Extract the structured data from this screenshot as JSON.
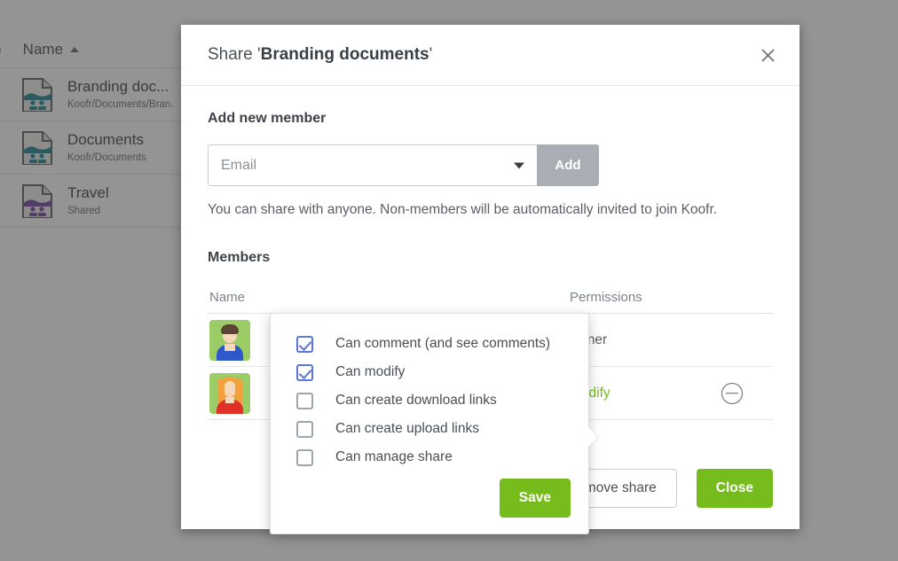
{
  "background": {
    "column_header": {
      "name_label": "Name",
      "sort_icon": "caret-up-icon",
      "left_paren": ")"
    },
    "rows": [
      {
        "title": "Branding doc...",
        "subtitle": "Koofr/Documents/Bran.",
        "icon": "shared-folder-icon",
        "accent": "#1a7f8e"
      },
      {
        "title": "Documents",
        "subtitle": "Koofr/Documents",
        "icon": "shared-folder-icon",
        "accent": "#1a7f8e"
      },
      {
        "title": "Travel",
        "subtitle": "Shared",
        "icon": "shared-folder-icon",
        "accent": "#6b3f9e"
      }
    ]
  },
  "dialog": {
    "title_prefix": "Share '",
    "title_bold": "Branding documents",
    "title_suffix": "'",
    "close_icon": "close-icon",
    "add_member": {
      "section_title": "Add new member",
      "email_placeholder": "Email",
      "email_value": "",
      "dropdown_icon": "chevron-down-icon",
      "add_label": "Add",
      "note": "You can share with anyone. Non-members will be automatically invited to join Koofr."
    },
    "members": {
      "section_title": "Members",
      "columns": {
        "name": "Name",
        "permissions": "Permissions",
        "actions": ""
      },
      "rows": [
        {
          "name": "",
          "permission": "owner",
          "permission_style": "plain",
          "avatar": "avatar-male-blue",
          "action_icon": ""
        },
        {
          "name": "",
          "permission": "modify",
          "permission_style": "green",
          "avatar": "avatar-female-red",
          "action_icon": "remove-member-icon"
        }
      ]
    },
    "footer": {
      "remove_share_label": "Remove share",
      "close_label": "Close"
    }
  },
  "permissions_popup": {
    "items": [
      {
        "label": "Can comment (and see comments)",
        "checked": true
      },
      {
        "label": "Can modify",
        "checked": true
      },
      {
        "label": "Can create download links",
        "checked": false
      },
      {
        "label": "Can create upload links",
        "checked": false
      },
      {
        "label": "Can manage share",
        "checked": false
      }
    ],
    "save_label": "Save"
  },
  "colors": {
    "brand_green": "#76bc1c",
    "checkbox_blue": "#5b76dd",
    "add_button_gray": "#a8aeb4",
    "avatar_bg": "#9ccc65"
  }
}
